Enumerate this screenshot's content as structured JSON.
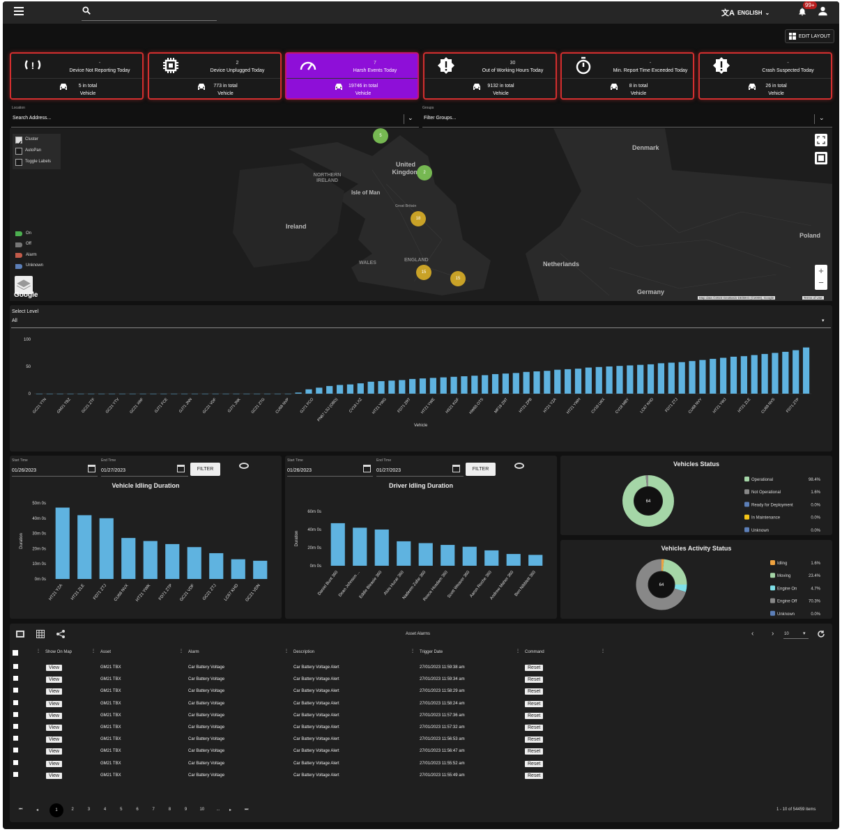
{
  "header": {
    "language": "ENGLISH",
    "notifications_badge": "99+"
  },
  "toolbar": {
    "edit_layout": "EDIT LAYOUT"
  },
  "cards": [
    {
      "value": "-",
      "label": "Device Not Reporting Today",
      "total": "5 in total",
      "unit": "Vehicle",
      "icon": "signal-lost-icon"
    },
    {
      "value": "2",
      "label": "Device Unplugged Today",
      "total": "773 in total",
      "unit": "Vehicle",
      "icon": "chip-icon"
    },
    {
      "value": "7",
      "label": "Harsh Events Today",
      "total": "19746 in total",
      "unit": "Vehicle",
      "icon": "speedometer-icon"
    },
    {
      "value": "30",
      "label": "Out of Working Hours Today",
      "total": "9132 in total",
      "unit": "Vehicle",
      "icon": "alert-icon"
    },
    {
      "value": "-",
      "label": "Min. Report Time Exceeded Today",
      "total": "8 in total",
      "unit": "Vehicle",
      "icon": "stopwatch-icon"
    },
    {
      "value": "-",
      "label": "Crash Suspected Today",
      "total": "26 in total",
      "unit": "Vehicle",
      "icon": "alert-icon"
    }
  ],
  "filters": {
    "location_label": "Location",
    "location_placeholder": "Search Address...",
    "groups_label": "Groups",
    "groups_placeholder": "Filter Groups..."
  },
  "map": {
    "options": [
      "Cluster",
      "AutoPan",
      "Toggle Labels"
    ],
    "legend": [
      {
        "label": "On",
        "color": "#4caf50"
      },
      {
        "label": "Off",
        "color": "#777777"
      },
      {
        "label": "Alarm",
        "color": "#c25b4a"
      },
      {
        "label": "Unknown",
        "color": "#5c7fb8"
      }
    ],
    "labels": [
      "Denmark",
      "NORTHERN IRELAND",
      "United Kingdom",
      "Isle of Man",
      "Great Britain",
      "Ireland",
      "WALES",
      "ENGLAND",
      "Netherlands",
      "Poland",
      "Germany"
    ],
    "clusters": [
      "5",
      "2",
      "18",
      "15",
      "15"
    ],
    "attribution": "Map data ©2023 GeoBasis-DE/BKG (©2009), Google",
    "terms": "Terms of Use",
    "google": "Google"
  },
  "level": {
    "label": "Select Level",
    "value": "All"
  },
  "chart_data": [
    {
      "type": "bar",
      "xlabel": "Vehicle",
      "ylim": [
        0,
        100
      ],
      "yticks": [
        0,
        50,
        100
      ],
      "tick_labels": [
        "GC21 YTN",
        "GM21 TBZ",
        "GC21 ZTF",
        "GC21 YTV",
        "GC21 XRF",
        "GJ71 FCE",
        "GJ71 JNN",
        "GC21 VDF",
        "GJ71 JNK",
        "GC21 ZTG",
        "CU68 NVP",
        "GJ71 FCO",
        "PN67 LSJ (OBD)",
        "CV18 LXZ",
        "HT21 YWG",
        "FD71 ZRT",
        "HT21 YWE",
        "HS21 KGF",
        "HW65 OTS",
        "MF18 ZNT",
        "HT21 ZPB",
        "HT21 YZA",
        "HT21 YWH",
        "CV18 LWX",
        "CV18 MBY",
        "LC67 KHD",
        "FD71 ZTJ",
        "CU68 NVY",
        "HT21 YWJ",
        "HT21 ZLE",
        "CU68 NVS",
        "FD71 ZTP"
      ],
      "values": [
        0,
        0,
        0,
        0,
        0,
        0,
        0,
        0,
        0,
        0,
        0,
        0,
        0,
        0,
        0,
        0,
        0,
        0,
        0,
        0,
        0,
        0,
        0,
        0,
        0,
        2,
        8,
        11,
        14,
        16,
        17,
        19,
        22,
        23,
        24,
        25,
        27,
        28,
        29,
        30,
        31,
        32,
        33,
        34,
        36,
        37,
        38,
        40,
        41,
        42,
        44,
        45,
        46,
        48,
        49,
        50,
        51,
        52,
        53,
        54,
        56,
        57,
        58,
        60,
        62,
        64,
        66,
        68,
        69,
        71,
        73,
        75,
        77,
        80,
        85
      ]
    },
    {
      "type": "bar",
      "title": "Vehicle Idling Duration",
      "ylabel": "Duration",
      "yticks": [
        "0m 0s",
        "10m 0s",
        "20m 0s",
        "30m 0s",
        "40m 0s",
        "50m 0s"
      ],
      "ylim": [
        0,
        50
      ],
      "categories": [
        "HT21 YZA",
        "HT21 ZLE",
        "FD71 ZTJ",
        "CU68 NVX",
        "HT21 YWK",
        "FD71 ZTP",
        "GC21 VDF",
        "GC21 ZTJ",
        "LC67 KHD",
        "GC21 VDN"
      ],
      "values": [
        47,
        42,
        40,
        27,
        25,
        23,
        21,
        17,
        13,
        12
      ]
    },
    {
      "type": "bar",
      "title": "Driver Idling Duration",
      "ylabel": "Duration",
      "yticks": [
        "0m 0s",
        "20m 0s",
        "40m 0s",
        "60m 0s"
      ],
      "ylim": [
        0,
        60
      ],
      "categories": [
        "Daniel Bunt 360",
        "Dean Johnson ...",
        "Eddie Bleasie 360",
        "Alois Huzar 360",
        "Nadeem Zafar 360",
        "Reece Hosdam 360",
        "Scott Weaver 360",
        "Aaron Roche 360",
        "Andrew Maher 360",
        "Ben Nibblett 360"
      ],
      "values": [
        47,
        42,
        40,
        27,
        25,
        23,
        21,
        17,
        13,
        12
      ]
    },
    {
      "type": "pie",
      "title": "Vehicles Status",
      "center": "64",
      "labels": [
        "Operational",
        "Not Operational",
        "Ready for Deployment",
        "In Maintenance",
        "Unknown"
      ],
      "values": [
        98.4,
        1.6,
        0,
        0,
        0
      ],
      "display": [
        "98.4%",
        "1.6%",
        "0.0%",
        "0.0%",
        "0.0%"
      ],
      "colors": [
        "#a5d6a7",
        "#888888",
        "#5c7fb8",
        "#f5c518",
        "#5c7fb8"
      ]
    },
    {
      "type": "pie",
      "title": "Vehicles Activity Status",
      "center": "64",
      "labels": [
        "Idling",
        "Moving",
        "Engine On",
        "Engine Off",
        "Unknown"
      ],
      "values": [
        1.6,
        23.4,
        4.7,
        70.3,
        0
      ],
      "display": [
        "1.6%",
        "23.4%",
        "4.7%",
        "70.3%",
        "0.0%"
      ],
      "colors": [
        "#f0a340",
        "#a5d6a7",
        "#7fe0e8",
        "#888888",
        "#5c7fb8"
      ]
    }
  ],
  "idling": {
    "vehicle": {
      "start_label": "Start Time",
      "start": "01/26/2023",
      "end_label": "End Time",
      "end": "01/27/2023",
      "filter": "FILTER"
    },
    "driver": {
      "start_label": "Start Time",
      "start": "01/26/2023",
      "end_label": "End Time",
      "end": "01/27/2023",
      "filter": "FILTER"
    }
  },
  "alarms": {
    "title": "Asset Alarms",
    "page_size": "10",
    "columns": [
      "Show On Map",
      "Asset",
      "Alarm",
      "Description",
      "Trigger Date",
      "Command"
    ],
    "rows": [
      {
        "view": "View",
        "asset": "GM21 TBX",
        "alarm": "Car Battery Voltage",
        "desc": "Car Battery Voltage Alert",
        "date": "27/01/2023 11:59:38 am",
        "cmd": "Reset"
      },
      {
        "view": "View",
        "asset": "GM21 TBX",
        "alarm": "Car Battery Voltage",
        "desc": "Car Battery Voltage Alert",
        "date": "27/01/2023 11:59:34 am",
        "cmd": "Reset"
      },
      {
        "view": "View",
        "asset": "GM21 TBX",
        "alarm": "Car Battery Voltage",
        "desc": "Car Battery Voltage Alert",
        "date": "27/01/2023 11:58:29 am",
        "cmd": "Reset"
      },
      {
        "view": "View",
        "asset": "GM21 TBX",
        "alarm": "Car Battery Voltage",
        "desc": "Car Battery Voltage Alert",
        "date": "27/01/2023 11:58:24 am",
        "cmd": "Reset"
      },
      {
        "view": "View",
        "asset": "GM21 TBX",
        "alarm": "Car Battery Voltage",
        "desc": "Car Battery Voltage Alert",
        "date": "27/01/2023 11:57:36 am",
        "cmd": "Reset"
      },
      {
        "view": "View",
        "asset": "GM21 TBX",
        "alarm": "Car Battery Voltage",
        "desc": "Car Battery Voltage Alert",
        "date": "27/01/2023 11:57:32 am",
        "cmd": "Reset"
      },
      {
        "view": "View",
        "asset": "GM21 TBX",
        "alarm": "Car Battery Voltage",
        "desc": "Car Battery Voltage Alert",
        "date": "27/01/2023 11:56:53 am",
        "cmd": "Reset"
      },
      {
        "view": "View",
        "asset": "GM21 TBX",
        "alarm": "Car Battery Voltage",
        "desc": "Car Battery Voltage Alert",
        "date": "27/01/2023 11:56:47 am",
        "cmd": "Reset"
      },
      {
        "view": "View",
        "asset": "GM21 TBX",
        "alarm": "Car Battery Voltage",
        "desc": "Car Battery Voltage Alert",
        "date": "27/01/2023 11:55:52 am",
        "cmd": "Reset"
      },
      {
        "view": "View",
        "asset": "GM21 TBX",
        "alarm": "Car Battery Voltage",
        "desc": "Car Battery Voltage Alert",
        "date": "27/01/2023 11:55:49 am",
        "cmd": "Reset"
      }
    ],
    "pages": [
      "1",
      "2",
      "3",
      "4",
      "5",
      "6",
      "7",
      "8",
      "9",
      "10",
      "..."
    ],
    "summary": "1 - 10 of 54459 items"
  }
}
